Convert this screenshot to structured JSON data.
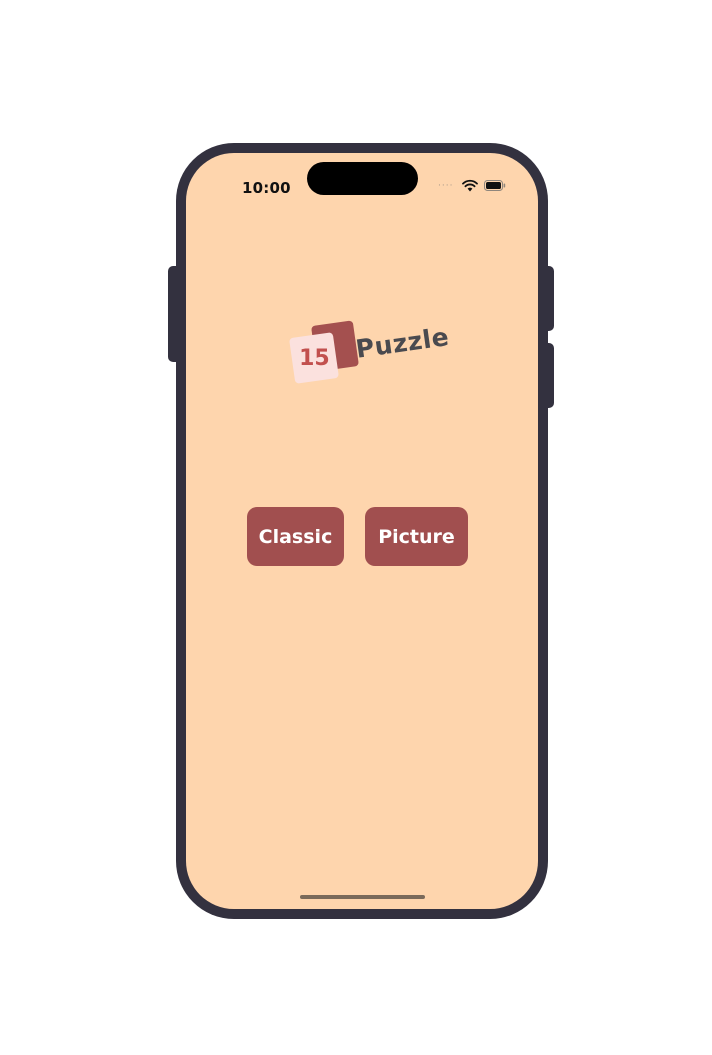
{
  "status_bar": {
    "time": "10:00",
    "signal_dots": "····",
    "wifi_icon": "wifi-icon",
    "battery_icon": "battery-icon"
  },
  "logo": {
    "number": "15",
    "word": "Puzzle"
  },
  "buttons": {
    "classic_label": "Classic",
    "picture_label": "Picture"
  },
  "colors": {
    "background": "#fed5ad",
    "accent": "#a14f4f",
    "device_frame": "#33313f"
  }
}
